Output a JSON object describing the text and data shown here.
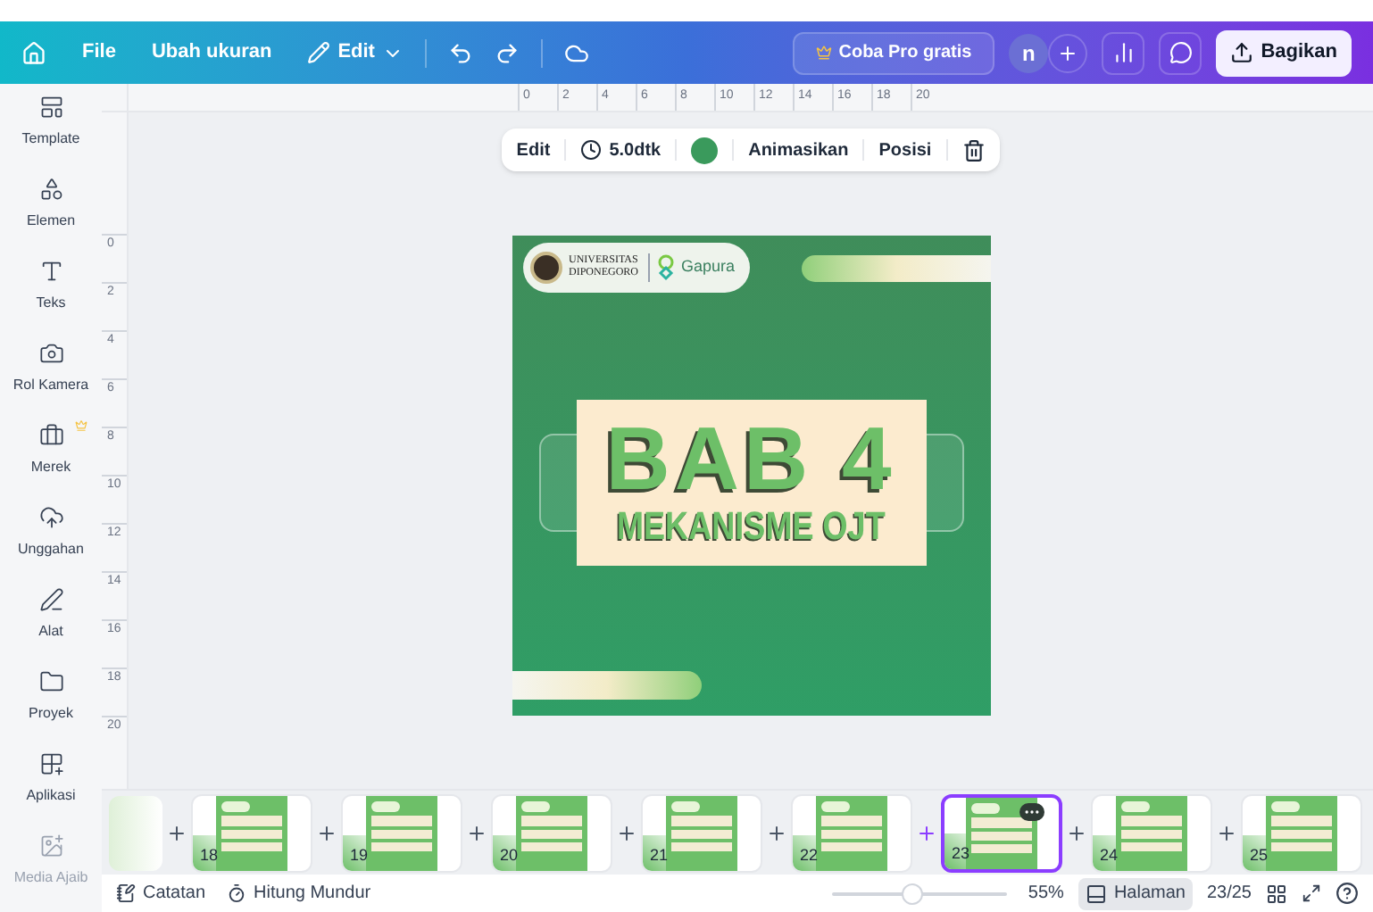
{
  "toolbar": {
    "menu": [
      "File",
      "Ubah ukuran"
    ],
    "edit": "Edit",
    "pro": "Coba Pro gratis",
    "avatar": "n",
    "share": "Bagikan"
  },
  "sidebar": {
    "items": [
      {
        "label": "Template",
        "kind": "template",
        "disabled": false
      },
      {
        "label": "Elemen",
        "kind": "elements",
        "disabled": false
      },
      {
        "label": "Teks",
        "kind": "text",
        "disabled": false
      },
      {
        "label": "Rol Kamera",
        "kind": "camera",
        "disabled": false
      },
      {
        "label": "Merek",
        "kind": "brand",
        "disabled": false
      },
      {
        "label": "Unggahan",
        "kind": "upload",
        "disabled": false
      },
      {
        "label": "Alat",
        "kind": "tools",
        "disabled": false
      },
      {
        "label": "Proyek",
        "kind": "projects",
        "disabled": false
      },
      {
        "label": "Aplikasi",
        "kind": "apps",
        "disabled": false
      },
      {
        "label": "Media Ajaib",
        "kind": "magic",
        "disabled": true
      }
    ]
  },
  "rulers": {
    "horizontal": [
      "0",
      "2",
      "4",
      "6",
      "8",
      "10",
      "12",
      "14",
      "16",
      "18",
      "20"
    ],
    "vertical": [
      "0",
      "2",
      "4",
      "6",
      "8",
      "10",
      "12",
      "14",
      "16",
      "18",
      "20"
    ]
  },
  "element_toolbar": {
    "edit": "Edit",
    "duration": "5.0dtk",
    "color": "#3a9a5c",
    "animate": "Animasikan",
    "position": "Posisi"
  },
  "design": {
    "university": "UNIVERSITAS DIPONEGORO",
    "partner": "Gapura",
    "title": "BAB 4",
    "subtitle": "MEKANISME OJT"
  },
  "pages": [
    {
      "number": "18",
      "selected": false
    },
    {
      "number": "19",
      "selected": false
    },
    {
      "number": "20",
      "selected": false
    },
    {
      "number": "21",
      "selected": false
    },
    {
      "number": "22",
      "selected": false
    },
    {
      "number": "23",
      "selected": true
    },
    {
      "number": "24",
      "selected": false
    },
    {
      "number": "25",
      "selected": false
    }
  ],
  "footer": {
    "notes": "Catatan",
    "timer": "Hitung Mundur",
    "zoom": {
      "level": 0.46,
      "reading": "55%"
    },
    "view": "Halaman",
    "page_count": "23/25"
  }
}
